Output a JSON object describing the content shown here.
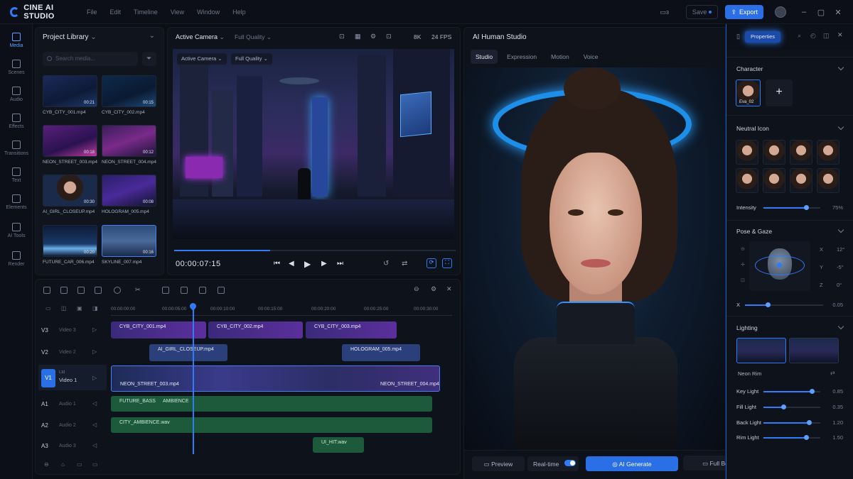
{
  "app": {
    "name": "CINE AI STUDIO"
  },
  "menu": [
    "File",
    "Edit",
    "Timeline",
    "View",
    "Window",
    "Help"
  ],
  "toolbar": {
    "save_label": "Save",
    "export_label": "Export",
    "notif_count": "3"
  },
  "rail": [
    "Media",
    "Scenes",
    "Audio",
    "Effects",
    "Transitions",
    "Text",
    "Elements",
    "AI Tools",
    "Render"
  ],
  "library": {
    "title": "Project Library",
    "search_placeholder": "Search media...",
    "items": [
      {
        "name": "CYB_CITY_001.mp4",
        "duration": "00:21"
      },
      {
        "name": "CYB_CITY_002.mp4",
        "duration": "00:15"
      },
      {
        "name": "NEON_STREET_003.mp4",
        "duration": "00:18"
      },
      {
        "name": "NEON_STREET_004.mp4",
        "duration": "00:12"
      },
      {
        "name": "AI_GIRL_CLOSEUP.mp4",
        "duration": "00:30"
      },
      {
        "name": "HOLOGRAM_005.mp4",
        "duration": "00:08"
      },
      {
        "name": "FUTURE_CAR_006.mp4",
        "duration": "00:20"
      },
      {
        "name": "SKYLINE_007.mp4",
        "duration": "00:16"
      }
    ]
  },
  "viewer": {
    "camera": "Active Camera",
    "quality": "Full Quality",
    "inner_camera": "Active Camera",
    "inner_quality": "Full Quality",
    "resolution": "8K",
    "fps": "24 FPS",
    "timecode": "00:00:07:15",
    "progress": 0.34,
    "accent": "#2f7cf6"
  },
  "timeline": {
    "ruler": [
      "00:00:00:00",
      "00:00:05:00",
      "00:00:10:00",
      "00:00:15:00",
      "00:00:20:00",
      "00:00:25:00",
      "00:00:30:00"
    ],
    "tracks": [
      {
        "id": "V3",
        "label": "Video 3"
      },
      {
        "id": "V2",
        "label": "Video 2"
      },
      {
        "id": "V1",
        "label": "Video 1",
        "sub": "Ltd"
      },
      {
        "id": "A1",
        "label": "Audio 1"
      },
      {
        "id": "A2",
        "label": "Audio 2"
      },
      {
        "id": "A3",
        "label": "Audio 3"
      }
    ],
    "clips": {
      "v3a": "CYB_CITY_001.mp4",
      "v3b": "CYB_CITY_002.mp4",
      "v3c": "CYB_CITY_003.mp4",
      "v2a": "AI_GIRL_CLOSEUP.mp4",
      "v2b": "HOLOGRAM_005.mp4",
      "v1a": "NEON_STREET_003.mp4",
      "v1b": "NEON_STREET_004.mp4",
      "a1a": "FUTURE_BASS",
      "a1b": "AMBIENCE",
      "a2a": "CITY_AMBIENCE.wav",
      "a3a": "UI_HIT.wav"
    }
  },
  "studio": {
    "title": "AI Human Studio",
    "tabs": [
      "Studio",
      "Expression",
      "Motion",
      "Voice"
    ],
    "bottom": {
      "preview": "Preview",
      "realtime": "Real-time",
      "generate": "AI Generate",
      "fullbody": "Full Body",
      "more": "···"
    }
  },
  "props": {
    "tab": "Properties",
    "character_title": "Character",
    "character_name": "Eva_02",
    "expression_title": "Neutral Icon",
    "intensity_label": "Intensity",
    "intensity_value": "75%",
    "intensity": 0.75,
    "pose_title": "Pose & Gaze",
    "pose": {
      "x": "12°",
      "y": "-5°",
      "z": "0°"
    },
    "x_label": "X",
    "x_value": "0.05",
    "lighting_title": "Lighting",
    "light_preset": "Neon Rim",
    "lights": [
      {
        "label": "Key Light",
        "value": "0.85",
        "level": 0.85
      },
      {
        "label": "Fill Light",
        "value": "0.35",
        "level": 0.35
      },
      {
        "label": "Back Light",
        "value": "1.20",
        "level": 0.8
      },
      {
        "label": "Rim Light",
        "value": "1.50",
        "level": 0.75
      }
    ]
  }
}
